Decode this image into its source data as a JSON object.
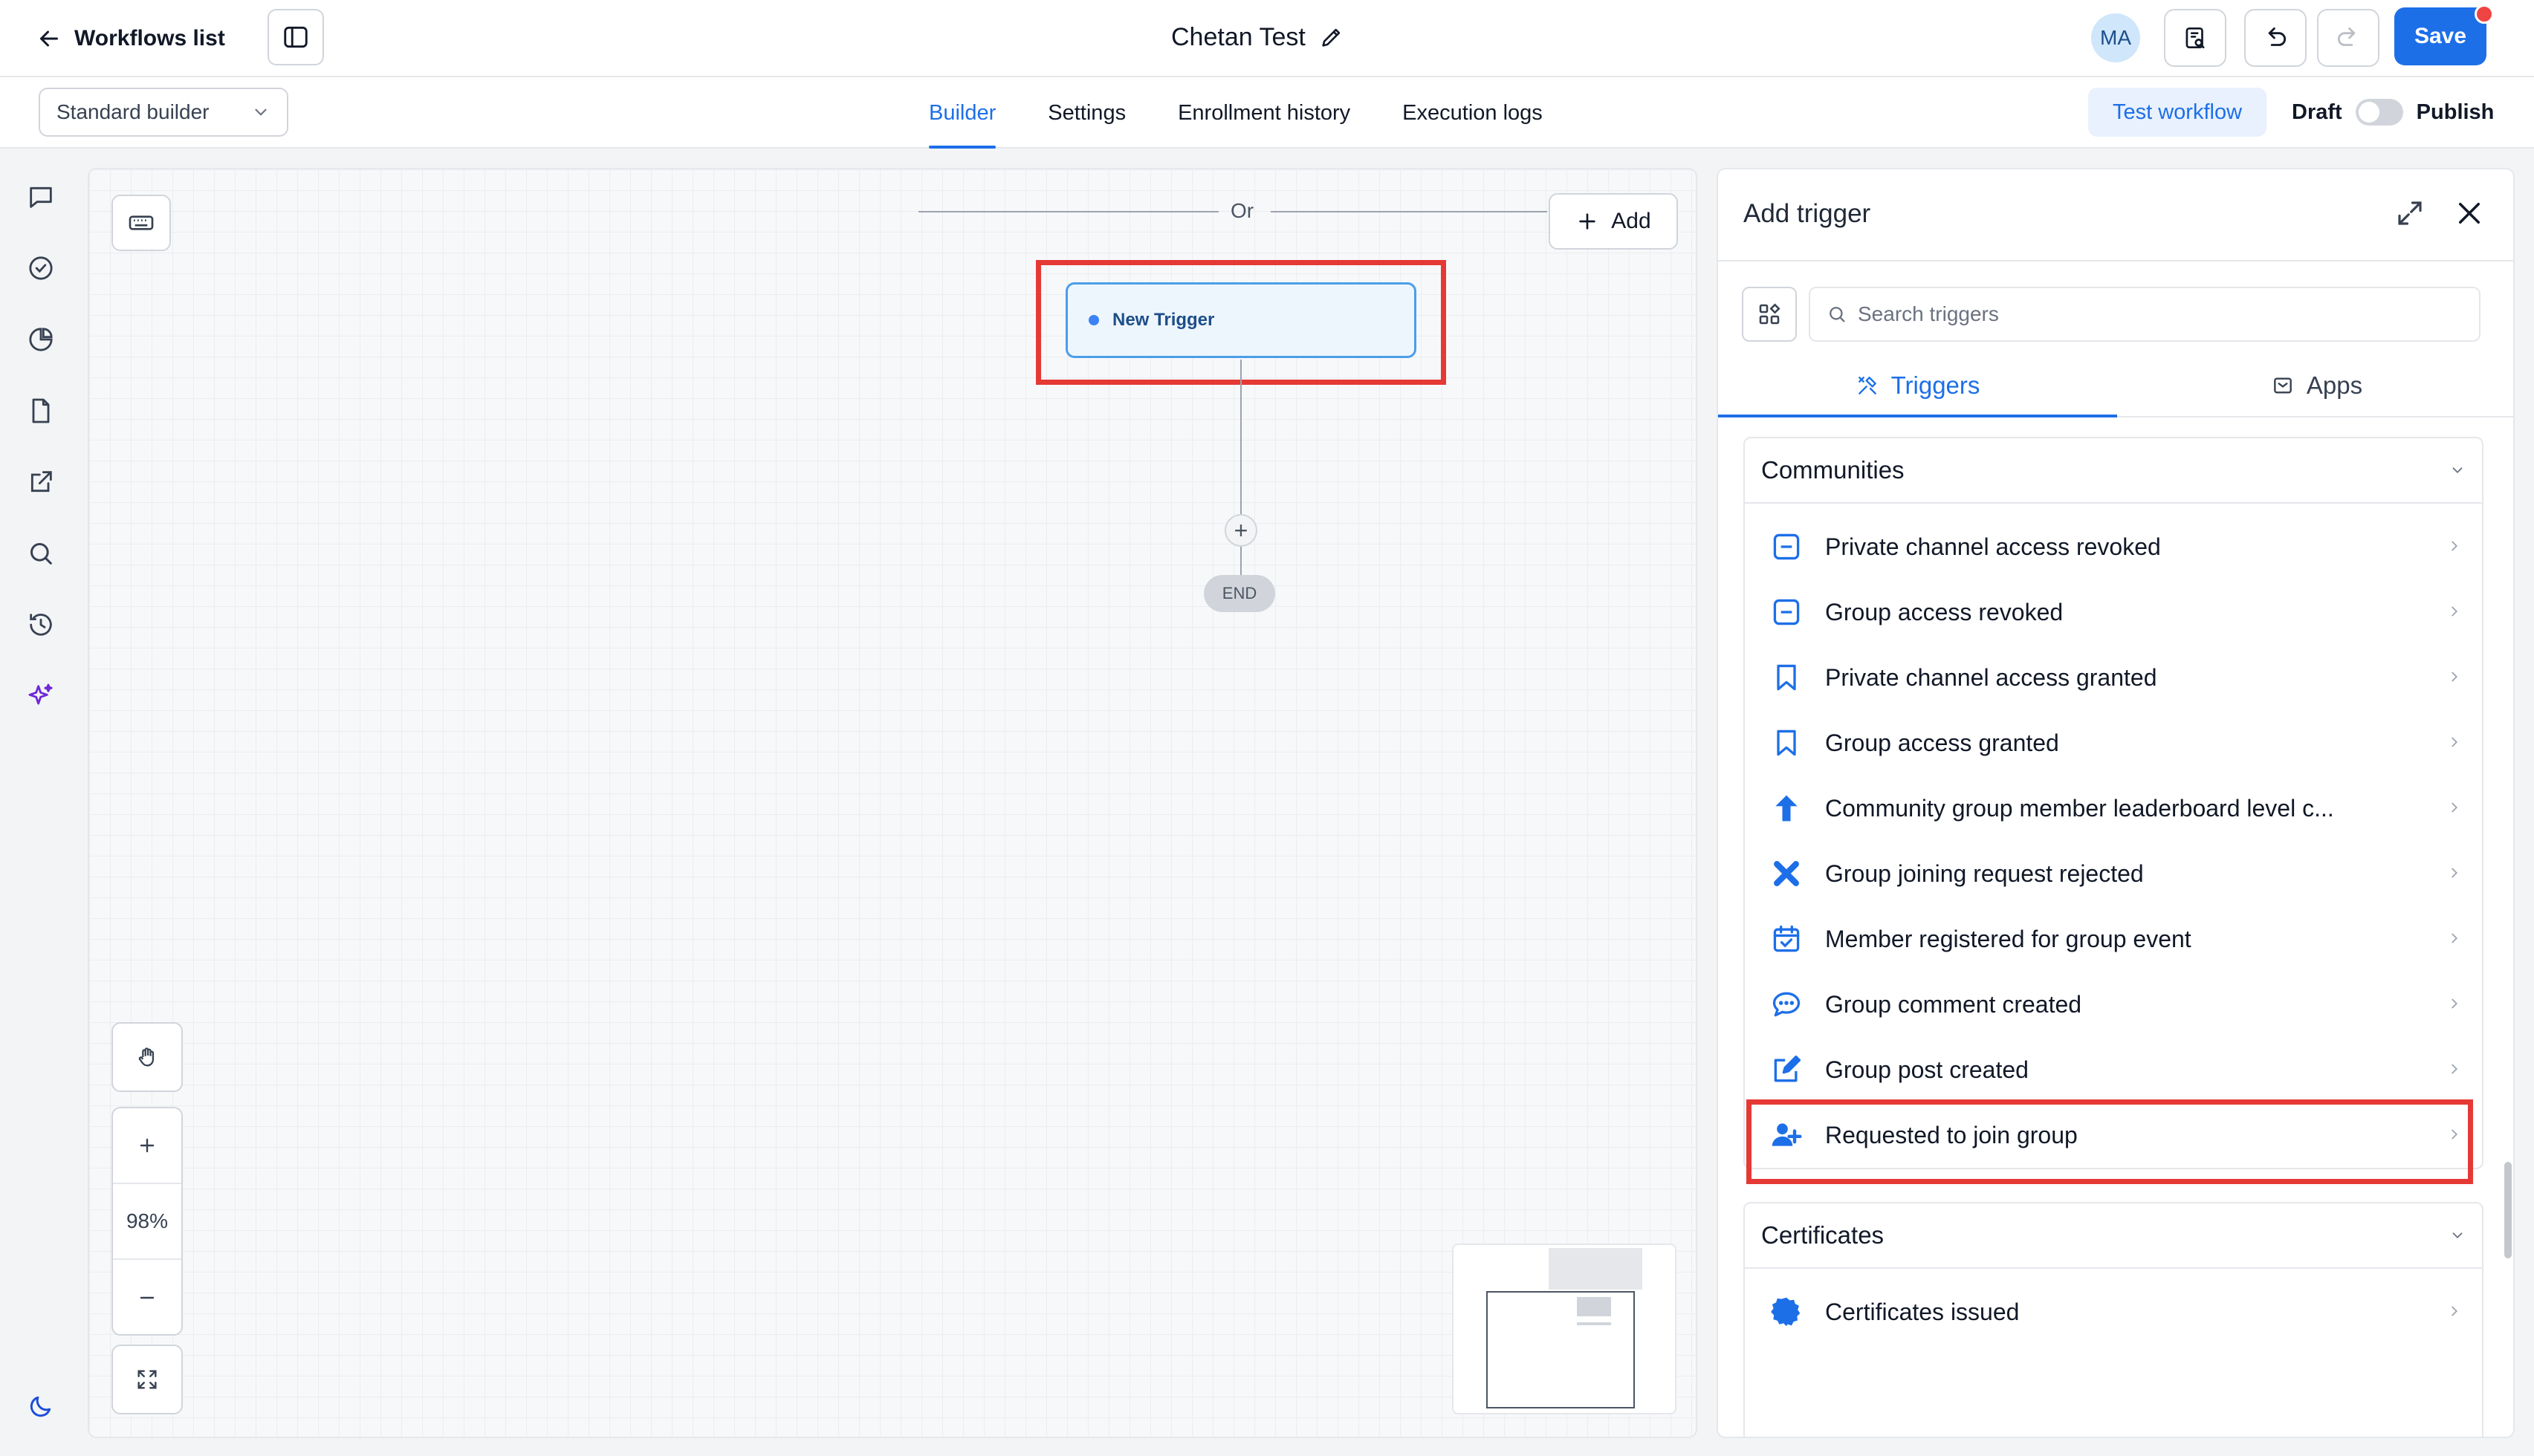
{
  "header": {
    "back_label": "Workflows list",
    "workflow_title": "Chetan Test",
    "avatar_initials": "MA",
    "save_label": "Save"
  },
  "subbar": {
    "builder_mode": "Standard builder",
    "tabs": [
      {
        "label": "Builder",
        "active": true
      },
      {
        "label": "Settings",
        "active": false
      },
      {
        "label": "Enrollment history",
        "active": false
      },
      {
        "label": "Execution logs",
        "active": false
      }
    ],
    "test_workflow_label": "Test workflow",
    "draft_label": "Draft",
    "publish_label": "Publish"
  },
  "rail": {
    "icons": [
      "chat-icon",
      "check-circle-icon",
      "pie-chart-icon",
      "document-icon",
      "external-link-icon",
      "search-icon",
      "history-icon",
      "sparkles-icon"
    ],
    "bottom_icon": "moon-icon"
  },
  "canvas": {
    "or_label": "Or",
    "add_label": "Add",
    "trigger_node_label": "New Trigger",
    "end_label": "END",
    "zoom_level": "98%"
  },
  "panel": {
    "title": "Add trigger",
    "search_placeholder": "Search triggers",
    "tabs": {
      "triggers": "Triggers",
      "apps": "Apps"
    },
    "sections": [
      {
        "title": "Communities",
        "items": [
          {
            "label": "Private channel access revoked",
            "icon": "minus-square-icon"
          },
          {
            "label": "Group access revoked",
            "icon": "minus-square-icon"
          },
          {
            "label": "Private channel access granted",
            "icon": "bookmark-icon"
          },
          {
            "label": "Group access granted",
            "icon": "bookmark-icon"
          },
          {
            "label": "Community group member leaderboard level c...",
            "icon": "arrow-up-icon"
          },
          {
            "label": "Group joining request rejected",
            "icon": "x-mark-icon"
          },
          {
            "label": "Member registered for group event",
            "icon": "calendar-check-icon"
          },
          {
            "label": "Group comment created",
            "icon": "comment-icon"
          },
          {
            "label": "Group post created",
            "icon": "edit-icon"
          },
          {
            "label": "Requested to join group",
            "icon": "user-plus-icon",
            "highlighted": true
          }
        ]
      },
      {
        "title": "Certificates",
        "items": [
          {
            "label": "Certificates issued",
            "icon": "badge-icon"
          }
        ]
      }
    ]
  },
  "colors": {
    "accent": "#1d6fe8",
    "highlight": "#e53935",
    "node_fill": "#eef6fd"
  }
}
